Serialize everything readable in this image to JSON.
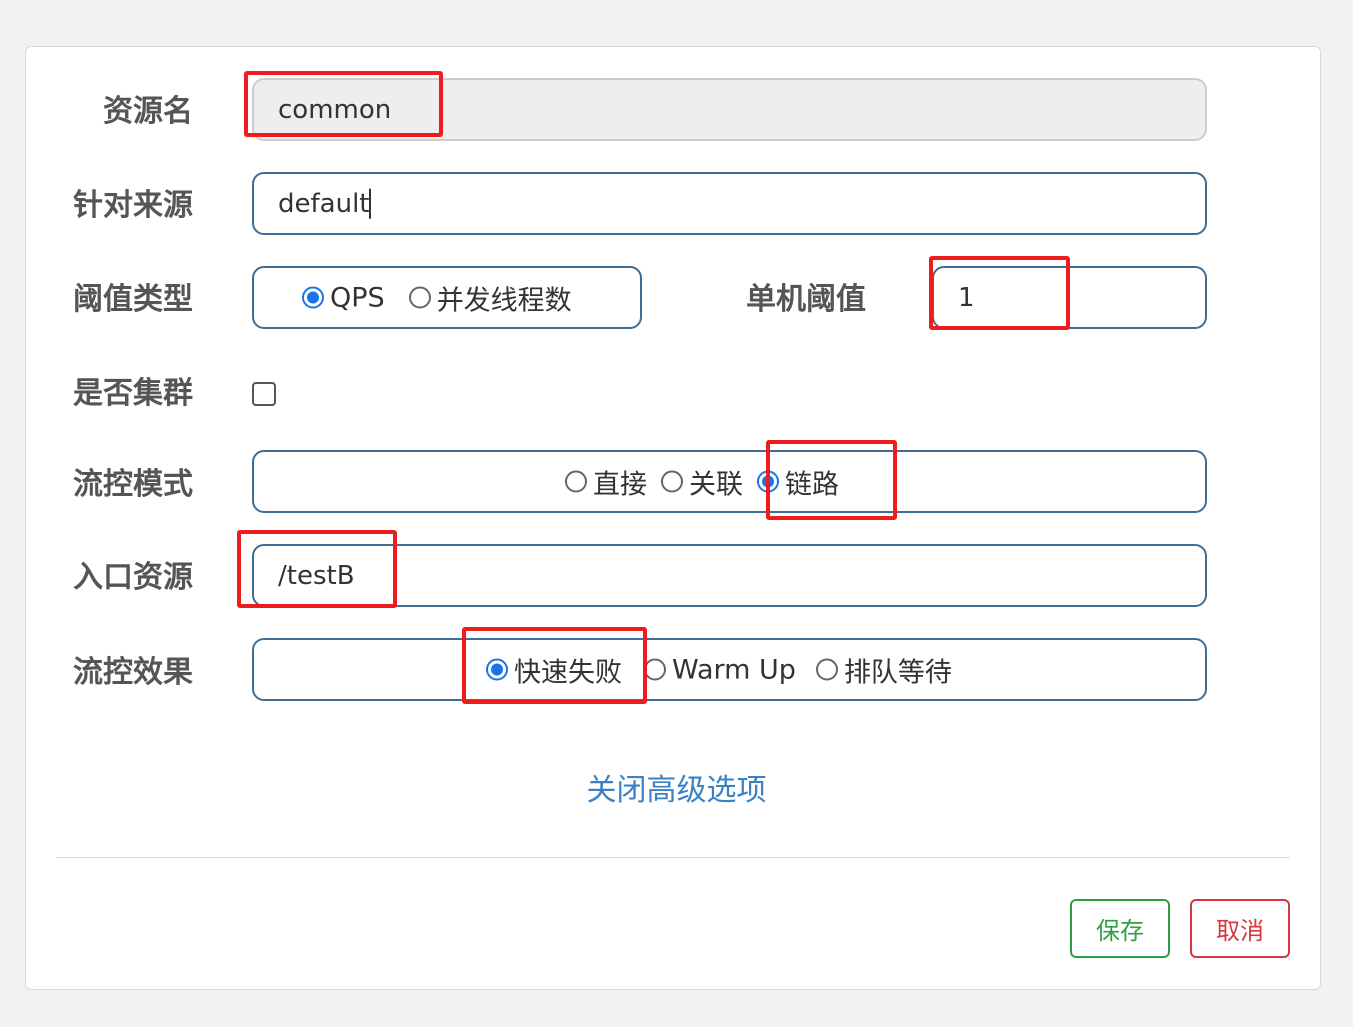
{
  "form": {
    "resource_name": {
      "label": "资源名",
      "value": "common"
    },
    "limit_origin": {
      "label": "针对来源",
      "value": "default"
    },
    "threshold_type": {
      "label": "阈值类型",
      "options": [
        "QPS",
        "并发线程数"
      ],
      "selected": "QPS"
    },
    "single_threshold": {
      "label": "单机阈值",
      "value": "1"
    },
    "cluster_mode": {
      "label": "是否集群",
      "checked": false
    },
    "flow_mode": {
      "label": "流控模式",
      "options": [
        "直接",
        "关联",
        "链路"
      ],
      "selected": "链路"
    },
    "entry_resource": {
      "label": "入口资源",
      "value": "/testB"
    },
    "flow_effect": {
      "label": "流控效果",
      "options": [
        "快速失败",
        "Warm Up",
        "排队等待"
      ],
      "selected": "快速失败"
    }
  },
  "advanced_link": "关闭高级选项",
  "buttons": {
    "save": "保存",
    "cancel": "取消"
  },
  "colors": {
    "accent": "#1a73e8",
    "field_border": "#3d6e98",
    "link": "#3a82c4",
    "save": "#2ea043",
    "cancel": "#d9363e",
    "highlight": "#ee1c1c"
  }
}
